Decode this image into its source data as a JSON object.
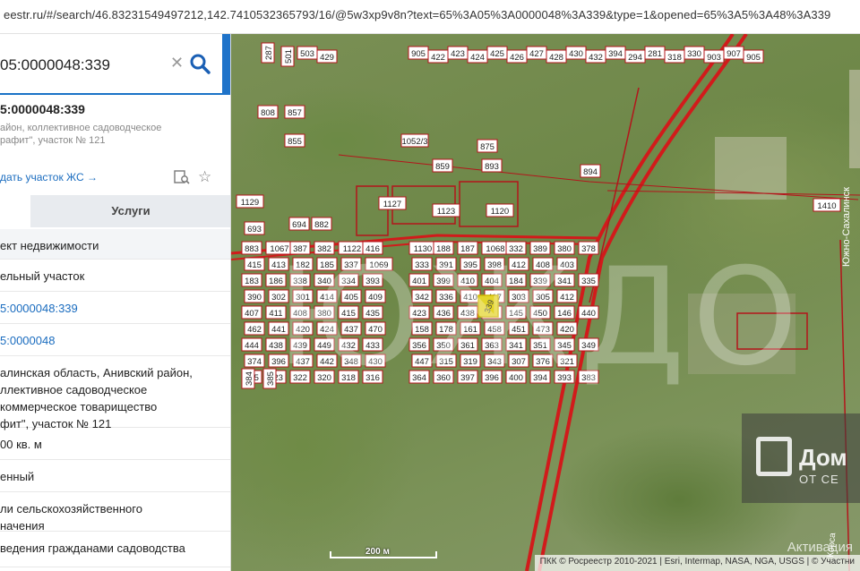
{
  "browser": {
    "url": "eestr.ru/#/search/46.83231549497212,142.7410532365793/16/@5w3xp9v8n?text=65%3A05%3A0000048%3A339&type=1&opened=65%3A5%3A48%3A339"
  },
  "search": {
    "query": "05:0000048:339",
    "clear_icon": "close-icon",
    "search_icon": "search-icon",
    "collapse_icon": "chevron-left-icon"
  },
  "card": {
    "title": "5:0000048:339",
    "subtitle": "айон, коллективное садоводческое\nрафит\", участок № 121",
    "action_link": "дать участок ЖС →"
  },
  "tabs": {
    "first": "",
    "second": "Услуги"
  },
  "details": [
    {
      "text": "ект недвижимости",
      "style": "alt"
    },
    {
      "text": "ельный участок",
      "style": "plain"
    },
    {
      "text": "5:0000048:339",
      "style": "link"
    },
    {
      "text": "5:0000048",
      "style": "link"
    },
    {
      "text": "алинская область, Анивский район,\nллективное садоводческое\nкоммерческое товарищество\nфит\", участок № 121",
      "style": "plain"
    },
    {
      "text": "00 кв. м",
      "style": "plain"
    },
    {
      "text": "енный",
      "style": "plain"
    },
    {
      "text": "ли сельскохозяйственного\nначения",
      "style": "plain"
    },
    {
      "text": "ведения гражданами садоводства",
      "style": "plain"
    }
  ],
  "map": {
    "parcels": [
      "287",
      "501",
      "503",
      "429",
      "905",
      "422",
      "423",
      "424",
      "425",
      "426",
      "427",
      "428",
      "430",
      "432",
      "394",
      "294",
      "281",
      "318",
      "330",
      "903",
      "907",
      "905",
      "808",
      "857",
      "855",
      "1052/3",
      "875",
      "859",
      "893",
      "894",
      "1127",
      "1123",
      "1120",
      "1410",
      "1129",
      "693",
      "694",
      "882",
      "883",
      "1067",
      "387",
      "382",
      "1122",
      "416",
      "1130",
      "188",
      "187",
      "1068",
      "332",
      "389",
      "380",
      "378",
      "415",
      "413",
      "182",
      "185",
      "337",
      "1069",
      "333",
      "391",
      "395",
      "398",
      "412",
      "408",
      "403",
      "183",
      "186",
      "338",
      "340",
      "334",
      "393",
      "401",
      "399",
      "410",
      "404",
      "184",
      "339",
      "341",
      "335",
      "390",
      "302",
      "301",
      "414",
      "405",
      "409",
      "342",
      "336",
      "410",
      "417",
      "303",
      "305",
      "412",
      "407",
      "411",
      "408",
      "380",
      "415",
      "435",
      "423",
      "436",
      "438",
      "312",
      "145",
      "450",
      "146",
      "440",
      "462",
      "441",
      "420",
      "424",
      "437",
      "470",
      "158",
      "178",
      "161",
      "458",
      "451",
      "473",
      "420",
      "444",
      "438",
      "439",
      "449",
      "432",
      "433",
      "356",
      "350",
      "361",
      "363",
      "341",
      "351",
      "345",
      "349",
      "374",
      "396",
      "437",
      "442",
      "348",
      "430",
      "447",
      "315",
      "319",
      "343",
      "307",
      "376",
      "321",
      "325",
      "323",
      "322",
      "320",
      "318",
      "316",
      "364",
      "360",
      "397",
      "396",
      "400",
      "394",
      "393",
      "383",
      "384",
      "385"
    ],
    "watermark": "ЮЖДО",
    "brand_name": "Дом",
    "brand_sub": "ОТ СЕ",
    "scale_label": "200 м",
    "attribution": "ПКК © Росреестр 2010-2021 | Esri, Intermap, NASA, NGA, USGS | © Участни",
    "activation": "Активация",
    "road_label": "Южно-Сахалинск",
    "road_label_2": "Корса"
  },
  "colors": {
    "accent": "#1a73c7",
    "parcel_border": "#b3151b",
    "selected_parcel": "#e3d52a",
    "road": "#d11b1b"
  }
}
